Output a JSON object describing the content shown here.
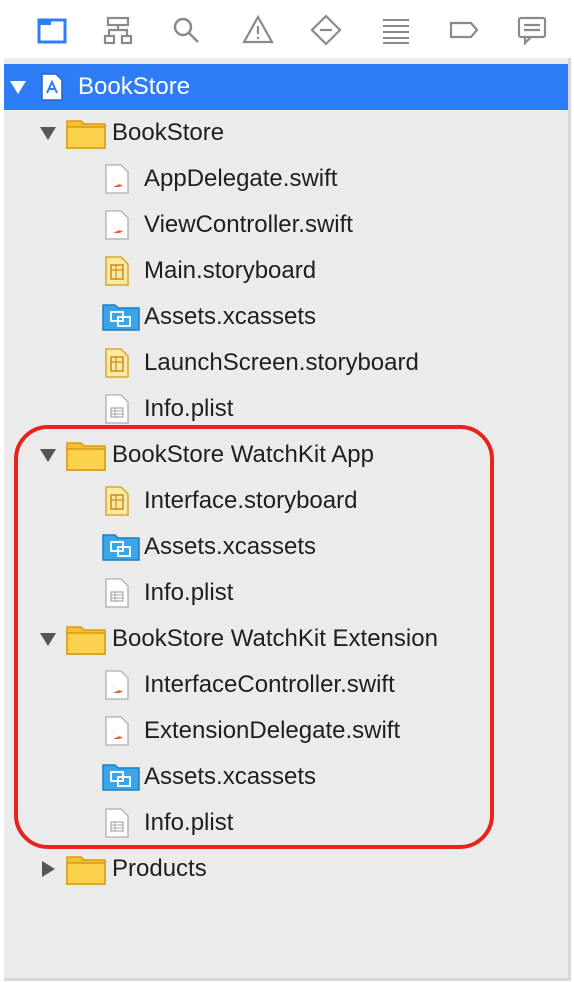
{
  "toolbar": {
    "items": [
      {
        "icon": "folder-navigator-icon",
        "active": true
      },
      {
        "icon": "hierarchy-icon"
      },
      {
        "icon": "search-icon"
      },
      {
        "icon": "warning-icon"
      },
      {
        "icon": "diamond-test-icon"
      },
      {
        "icon": "list-icon"
      },
      {
        "icon": "breakpoint-tag-icon"
      },
      {
        "icon": "comment-icon"
      }
    ]
  },
  "project": {
    "label": "BookStore",
    "icon": "xcode-project-icon"
  },
  "groups": {
    "bookstore": {
      "label": "BookStore",
      "files": [
        "AppDelegate.swift",
        "ViewController.swift",
        "Main.storyboard",
        "Assets.xcassets",
        "LaunchScreen.storyboard",
        "Info.plist"
      ]
    },
    "watchkit_app": {
      "label": "BookStore WatchKit App",
      "files": [
        "Interface.storyboard",
        "Assets.xcassets",
        "Info.plist"
      ]
    },
    "watchkit_extension": {
      "label": "BookStore WatchKit Extension",
      "files": [
        "InterfaceController.swift",
        "ExtensionDelegate.swift",
        "Assets.xcassets",
        "Info.plist"
      ]
    },
    "products": {
      "label": "Products"
    }
  },
  "colors": {
    "selection": "#2e7cf6",
    "highlight_outline": "#e8231f",
    "folder": "#f6c02f",
    "swift": "#f05138"
  }
}
